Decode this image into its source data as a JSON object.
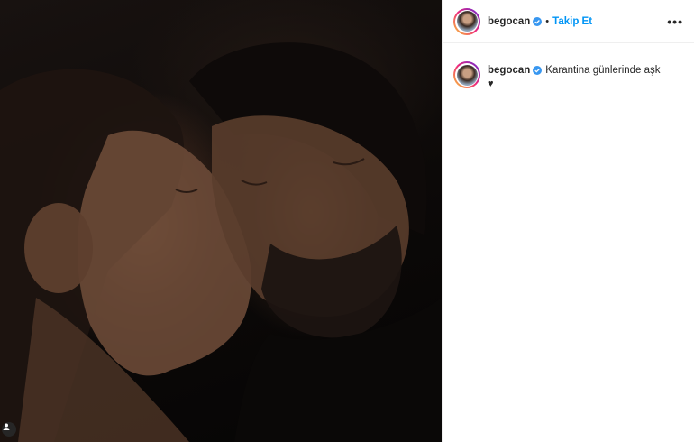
{
  "post": {
    "username": "begocan",
    "follow_label": "Takip Et",
    "separator": "•",
    "more_label": "•••"
  },
  "caption": {
    "username": "begocan",
    "text": "Karantina günlerinde aşk",
    "emoji": "♥"
  },
  "colors": {
    "link_blue": "#0095f6",
    "verified_blue": "#3897f0",
    "text": "#262626"
  },
  "icons": {
    "verified": "verified-badge-icon",
    "more": "more-options-icon",
    "user_tag": "user-tag-icon"
  }
}
